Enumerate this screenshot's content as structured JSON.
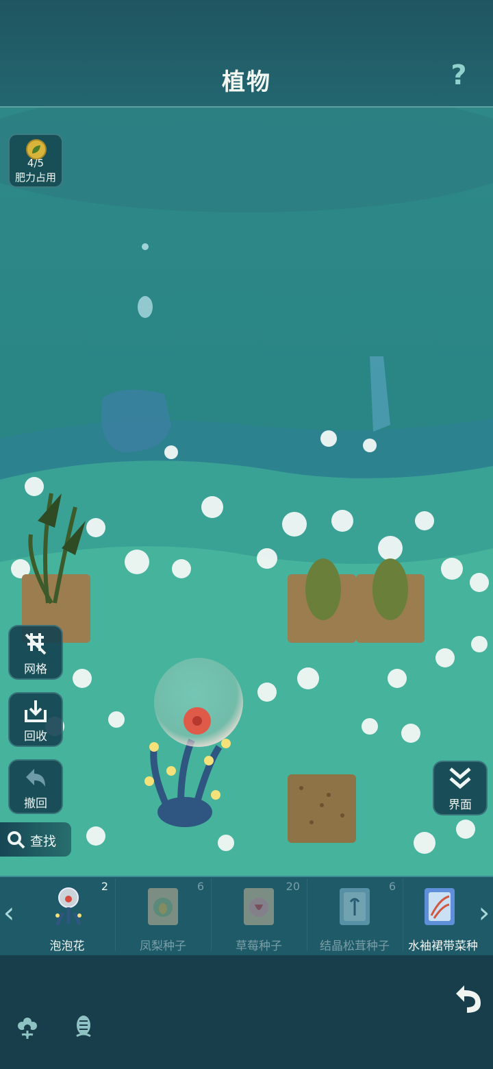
{
  "header": {
    "title": "植物",
    "help_icon": "question-icon"
  },
  "fertilizer": {
    "value": "4/5",
    "label": "肥力占用",
    "icon": "leaf-coin-icon"
  },
  "side_buttons": {
    "grid": {
      "label": "网格",
      "icon": "grid-toggle-icon"
    },
    "recycle": {
      "label": "回收",
      "icon": "recycle-icon"
    },
    "undo": {
      "label": "撤回",
      "icon": "undo-icon"
    },
    "interface": {
      "label": "界面",
      "icon": "double-chevron-down-icon"
    }
  },
  "search": {
    "label": "查找",
    "icon": "search-icon"
  },
  "tray": {
    "items": [
      {
        "name": "泡泡花",
        "count": "2"
      },
      {
        "name": "凤梨种子",
        "count": "6"
      },
      {
        "name": "草莓种子",
        "count": "20"
      },
      {
        "name": "结晶松茸种子",
        "count": "6"
      },
      {
        "name": "水袖裙带菜种",
        "count": ""
      }
    ]
  },
  "bottom_bar": {
    "left_icons": [
      "flower-icon",
      "seed-icon"
    ],
    "right_icon": "return-icon"
  },
  "colors": {
    "accent": "#8fd2cc",
    "panel": "#1e5a68",
    "background": "#2a7f84"
  }
}
